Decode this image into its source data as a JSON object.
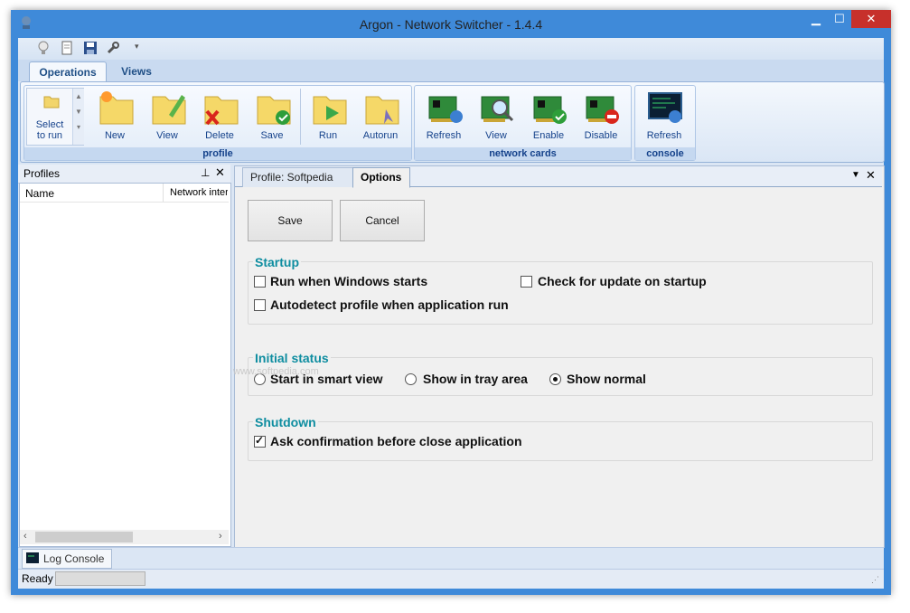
{
  "window": {
    "title": "Argon - Network Switcher - 1.4.4"
  },
  "ribbon": {
    "tabs": [
      {
        "label": "Operations"
      },
      {
        "label": "Views"
      }
    ],
    "select_to_run": "Select\nto run",
    "groups": {
      "profile": {
        "label": "profile",
        "buttons": [
          {
            "label": "New"
          },
          {
            "label": "View"
          },
          {
            "label": "Delete"
          },
          {
            "label": "Save"
          },
          {
            "label": "Run"
          },
          {
            "label": "Autorun"
          }
        ]
      },
      "network_cards": {
        "label": "network cards",
        "buttons": [
          {
            "label": "Refresh"
          },
          {
            "label": "View"
          },
          {
            "label": "Enable"
          },
          {
            "label": "Disable"
          }
        ]
      },
      "console": {
        "label": "console",
        "buttons": [
          {
            "label": "Refresh"
          }
        ]
      }
    }
  },
  "profiles_panel": {
    "title": "Profiles",
    "columns": [
      "Name",
      "Network interf"
    ]
  },
  "document": {
    "tabs": [
      {
        "label": "Profile: Softpedia"
      },
      {
        "label": "Options"
      }
    ],
    "save_label": "Save",
    "cancel_label": "Cancel",
    "startup": {
      "legend": "Startup",
      "run_windows": "Run when Windows starts",
      "check_update": "Check for update on startup",
      "autodetect": "Autodetect profile when application run"
    },
    "initial_status": {
      "legend": "Initial status",
      "smart_view": "Start in smart view",
      "tray": "Show in tray area",
      "normal": "Show normal",
      "selected": "Show normal"
    },
    "shutdown": {
      "legend": "Shutdown",
      "ask_confirm": "Ask confirmation before close application",
      "ask_confirm_checked": true
    },
    "watermark": "www.softpedia.com"
  },
  "log_console": {
    "label": "Log Console"
  },
  "status": {
    "text": "Ready"
  }
}
